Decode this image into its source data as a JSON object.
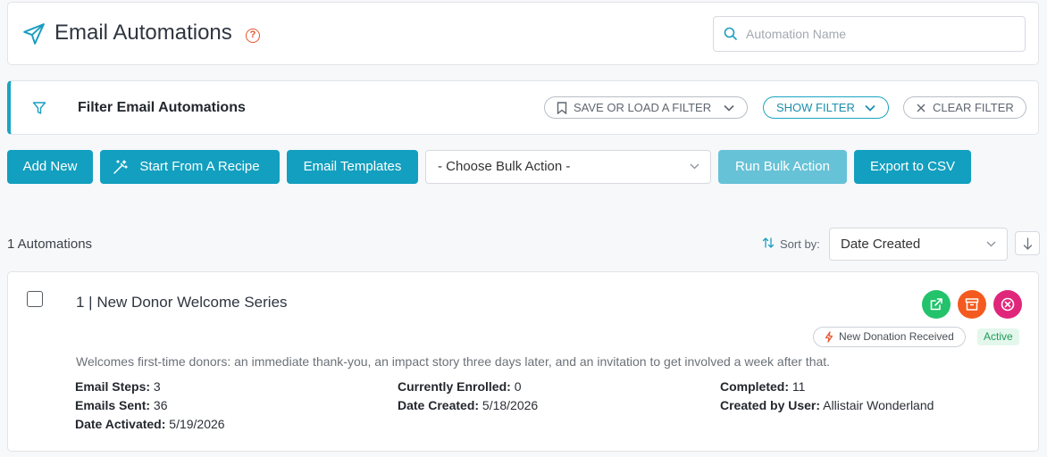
{
  "header": {
    "title": "Email Automations",
    "help_glyph": "?",
    "search_placeholder": "Automation Name"
  },
  "filter": {
    "title": "Filter Email Automations",
    "save_load_label": "SAVE OR LOAD A FILTER",
    "show_label": "SHOW FILTER",
    "clear_label": "CLEAR FILTER"
  },
  "toolbar": {
    "add_new": "Add New",
    "start_recipe": "Start From A Recipe",
    "email_templates": "Email Templates",
    "bulk_action_selected": "- Choose Bulk Action -",
    "run_bulk": "Run Bulk Action",
    "export_csv": "Export to CSV"
  },
  "list": {
    "count_label": "1 Automations",
    "sort_label": "Sort by:",
    "sort_selected": "Date Created"
  },
  "automation": {
    "name": "1 | New Donor Welcome Series",
    "trigger": "New Donation Received",
    "status": "Active",
    "description": "Welcomes first-time donors: an immediate thank-you, an impact story three days later, and an invitation to get involved a week after that.",
    "stats": {
      "email_steps_label": "Email Steps:",
      "email_steps": "3",
      "emails_sent_label": "Emails Sent:",
      "emails_sent": "36",
      "date_activated_label": "Date Activated:",
      "date_activated": "5/19/2026",
      "currently_enrolled_label": "Currently Enrolled:",
      "currently_enrolled": "0",
      "date_created_label": "Date Created:",
      "date_created": "5/18/2026",
      "completed_label": "Completed:",
      "completed": "11",
      "created_by_label": "Created by User:",
      "created_by": "Allistair Wonderland"
    }
  },
  "colors": {
    "accent": "#139fbf",
    "help": "#e8542e",
    "open_action": "#22c36b",
    "archive_action": "#f45a1f",
    "delete_action": "#e0267a",
    "status_active": "#1e9a55"
  },
  "icons": [
    "paper-plane-icon",
    "search-icon",
    "funnel-icon",
    "bookmark-icon",
    "chevron-down-icon",
    "close-icon",
    "magic-wand-icon",
    "sort-icon",
    "arrow-down-icon",
    "external-link-icon",
    "archive-icon",
    "delete-icon",
    "lightning-icon"
  ]
}
